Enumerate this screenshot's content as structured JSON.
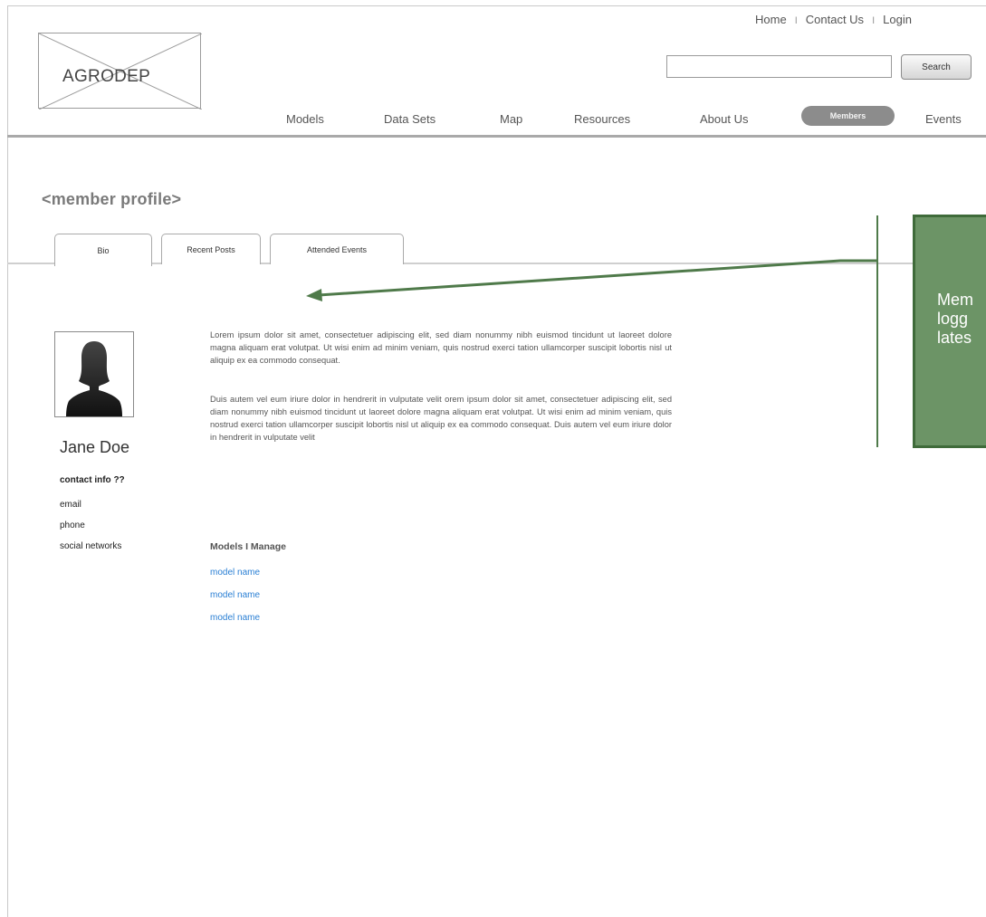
{
  "header": {
    "logo_text": "AGRODEP",
    "top_links": [
      "Home",
      "Contact Us",
      "Login"
    ],
    "separator": "I",
    "search": {
      "value": "",
      "button_label": "Search"
    },
    "nav": [
      "Models",
      "Data Sets",
      "Map",
      "Resources",
      "About Us",
      "Members",
      "Events"
    ],
    "active_nav": "Members"
  },
  "page": {
    "title": "<member profile>",
    "tabs": [
      "Bio",
      "Recent Posts",
      "Attended Events"
    ],
    "active_tab": "Bio"
  },
  "profile": {
    "name": "Jane Doe",
    "contact_heading": "contact info ??",
    "contact_items": [
      "email",
      "phone",
      "social networks"
    ]
  },
  "bio": {
    "paragraphs": [
      "Lorem ipsum dolor sit amet, consectetuer adipiscing elit, sed diam nonummy nibh euismod tincidunt ut laoreet dolore magna aliquam erat volutpat. Ut wisi enim ad minim veniam, quis nostrud exerci tation ullamcorper suscipit lobortis nisl ut aliquip ex ea commodo consequat.",
      "Duis autem vel eum iriure dolor in hendrerit in vulputate velit orem ipsum dolor sit amet, consectetuer adipiscing elit, sed diam nonummy nibh euismod tincidunt ut laoreet dolore magna aliquam erat volutpat. Ut wisi enim ad minim veniam, quis nostrud exerci tation ullamcorper suscipit lobortis nisl ut aliquip ex ea commodo consequat. Duis autem vel eum iriure dolor in hendrerit in vulputate velit"
    ],
    "models_heading": "Models I Manage",
    "models": [
      "model name",
      "model name",
      "model name"
    ]
  },
  "annotation": {
    "lines": [
      "Mem",
      "logg",
      "lates"
    ]
  },
  "colors": {
    "note_fill": "#6c9466",
    "note_border": "#3f6b3a",
    "arrow": "#4f7a4a",
    "link": "#2a7fd4",
    "active_nav": "#8c8c8c"
  }
}
